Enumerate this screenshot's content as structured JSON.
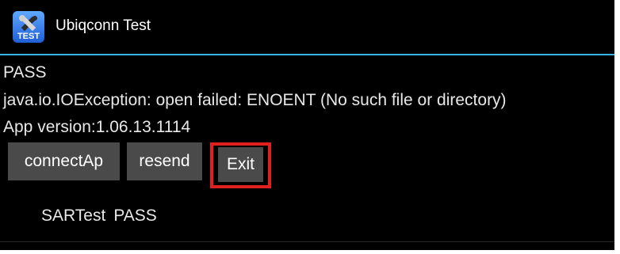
{
  "app": {
    "title": "Ubiqconn Test",
    "icon": "tools-test-icon",
    "icon_label": "TEST",
    "accent_color": "#33b5e5"
  },
  "content": {
    "status": "PASS",
    "error_message": "java.io.IOException: open failed: ENOENT (No such file or directory)",
    "app_version": "App version:1.06.13.1114"
  },
  "buttons": {
    "connect": "connectAp",
    "resend": "resend",
    "exit": "Exit"
  },
  "highlight_color": "#e0201f",
  "result": {
    "test_name": "SARTest",
    "test_status": "PASS"
  }
}
